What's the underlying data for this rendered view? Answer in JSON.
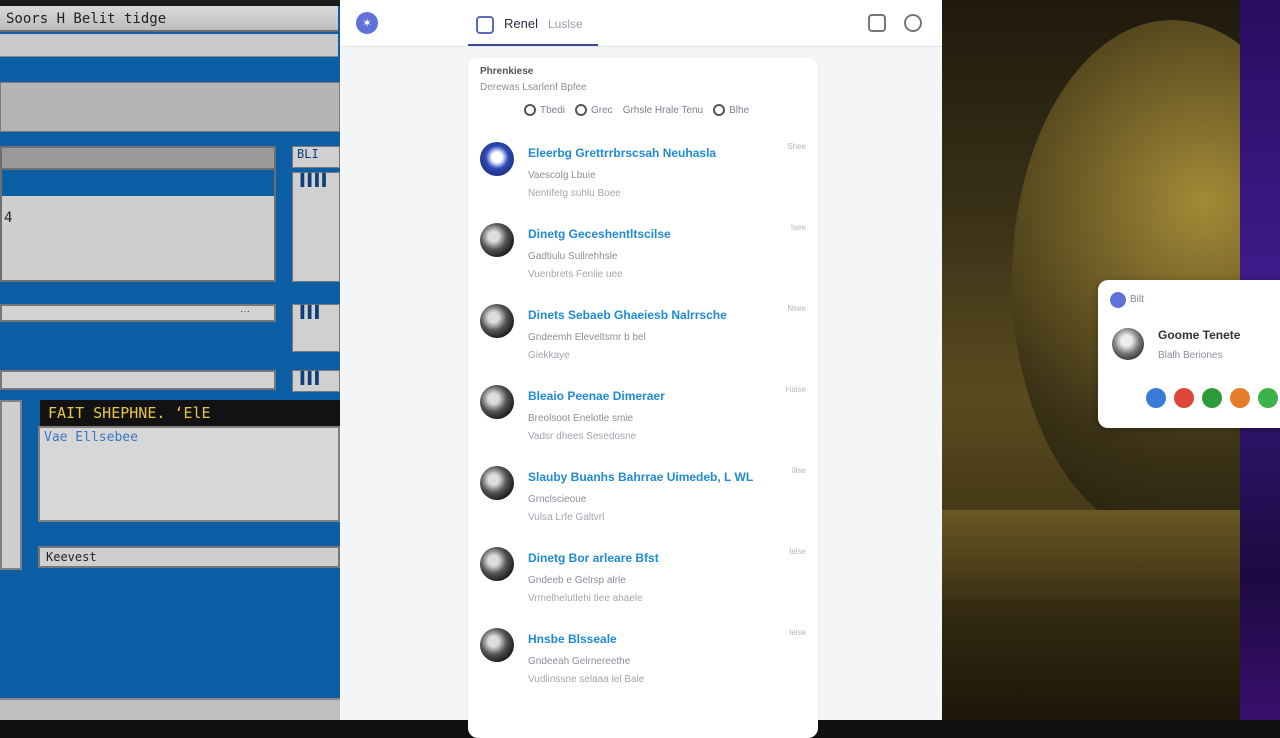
{
  "left_panel": {
    "title": "Soors  H Belit  tidge",
    "window_text": "4",
    "side_label_1": "BLI",
    "side_label_2": "▐▐▐▐",
    "side_label_3": "▐▐▐",
    "side_label_4": "▐▐▐",
    "bar_text_1": "···",
    "dark_line": "FAIT  SHEPHNE.  ‘ElE",
    "sub_line": "Vae  Ellsebee",
    "label": "Keevest"
  },
  "middle": {
    "tab_label": "Renel",
    "tab_secondary": "Luslse",
    "card_heading": "Phrenkiese",
    "card_subheading": "Derewas  Lsarlenf  Bpfee",
    "filters": [
      {
        "label": "Tbedi"
      },
      {
        "label": "Grec"
      },
      {
        "label": "Grhsle  Hrale  Tenu"
      },
      {
        "label": "Blhe"
      }
    ],
    "items": [
      {
        "title": "Eleerbg  Grettrrbrscsah  Neuhasla",
        "line1": "Vaescolg  Lbuie",
        "line2": "Nentifetg  suhlu  Boee",
        "time": "Shee",
        "avatar": "blue"
      },
      {
        "title": "Dinetg  Geceshentltscilse",
        "line1": "Gadtiulu  Sullrehhsle",
        "line2": "Vuenbrets  Fenlie  uee",
        "time": "Isee",
        "avatar": "dark"
      },
      {
        "title": "Dinets  Sebaeb  Ghaeiesb  Nalrrsche",
        "line1": "Gndeemh  Eleveltsmr  b  bel",
        "line2": "Giekkaye",
        "time": "Nsee",
        "avatar": "dark"
      },
      {
        "title": "Bleaio  Peenae  Dimeraer",
        "line1": "Breolsoot  Enelotle  smie",
        "line2": "Vadsr  dhees  Sesedosne",
        "time": "Halse",
        "avatar": "dark"
      },
      {
        "title": "Slauby  Buanhs  Bahrrae  Uimedeb,  L  WL",
        "line1": "Grnclscieoue",
        "line2": "Vulsa  Lrfe  Galtvrl",
        "time": "Iilse",
        "avatar": "dark"
      },
      {
        "title": "Dinetg  Bor  arleare  Bfst",
        "line1": "Gndeeb  e  Gelrsp  alrle",
        "line2": "Vrmelhelutlehi  tiee  ahaele",
        "time": "Ielse",
        "avatar": "dark"
      },
      {
        "title": "Hnsbe  Blsseale",
        "line1": "Gndeeah  Gelrnereethe",
        "line2": "Vudlinssne  selaaa  lel  Bale",
        "time": "Ielse",
        "avatar": "dark"
      }
    ]
  },
  "right_panel": {
    "popup_label": "Bilt",
    "popup_name": "Goome  Tenete",
    "popup_desc": "Blalh  Beriones",
    "reactions": [
      "#3a7bd5",
      "#e0453a",
      "#2c9b3a",
      "#e57c2a",
      "#3bb34a"
    ]
  }
}
